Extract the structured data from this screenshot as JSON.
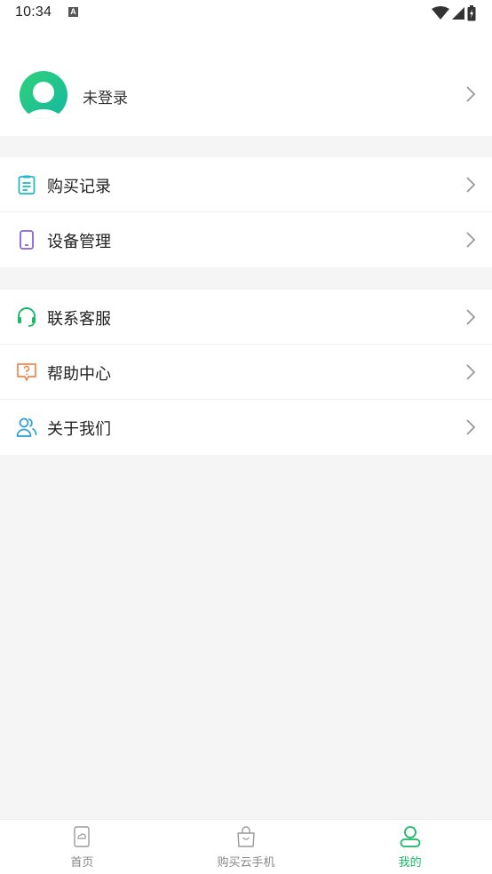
{
  "status_bar": {
    "time": "10:34",
    "notification_glyph": "A"
  },
  "profile": {
    "name": "未登录"
  },
  "menu_group_1": [
    {
      "label": "购买记录",
      "icon": "clipboard-icon",
      "color": "#23b7c9"
    },
    {
      "label": "设备管理",
      "icon": "phone-device-icon",
      "color": "#8d5fd3"
    }
  ],
  "menu_group_2": [
    {
      "label": "联系客服",
      "icon": "headset-icon",
      "color": "#19b866"
    },
    {
      "label": "帮助中心",
      "icon": "help-bubble-icon",
      "color": "#f0874c"
    },
    {
      "label": "关于我们",
      "icon": "users-icon",
      "color": "#2a9ed8"
    }
  ],
  "tabbar": {
    "items": [
      {
        "label": "首页",
        "icon": "home-icon",
        "active": false
      },
      {
        "label": "购买云手机",
        "icon": "shopping-bag-icon",
        "active": false
      },
      {
        "label": "我的",
        "icon": "profile-icon",
        "active": true
      }
    ]
  },
  "colors": {
    "accent": "#19b866",
    "background": "#f5f5f5"
  }
}
